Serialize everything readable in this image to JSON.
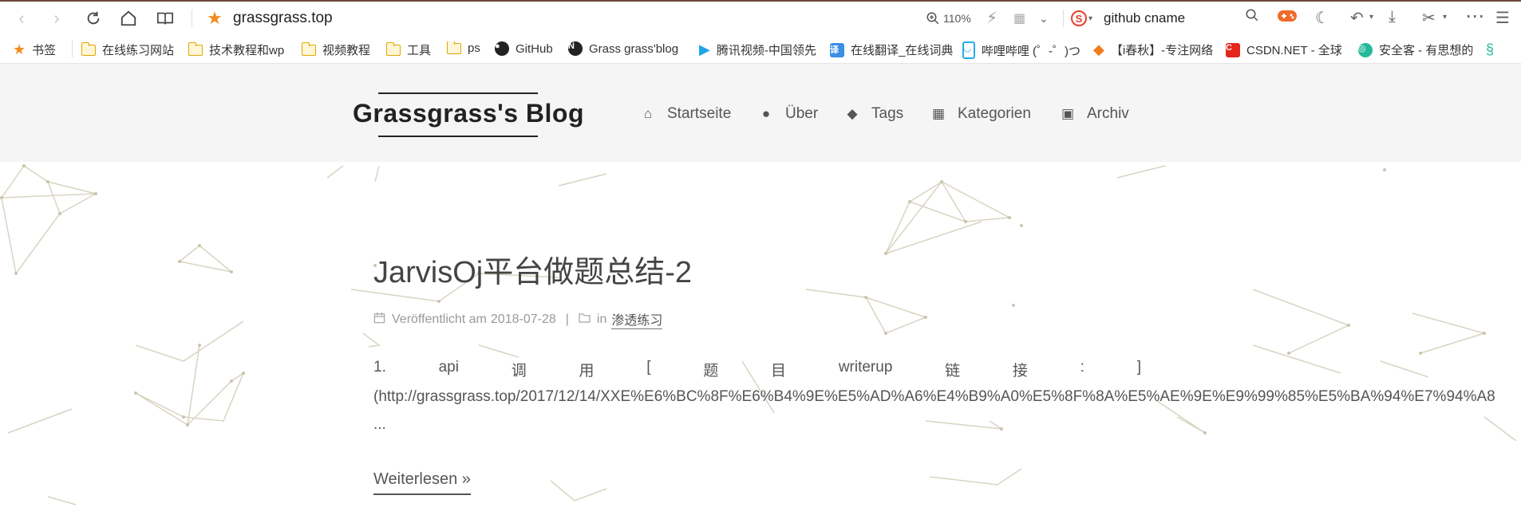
{
  "browser": {
    "url": "grassgrass.top",
    "zoom": "110%",
    "search_value": "github cname",
    "search_engine_icon": "S"
  },
  "bookmarks": [
    {
      "label": "书签",
      "icon": "star"
    },
    {
      "label": "在线练习网站",
      "icon": "folder"
    },
    {
      "label": "技术教程和wp",
      "icon": "folder"
    },
    {
      "label": "视频教程",
      "icon": "folder"
    },
    {
      "label": "工具",
      "icon": "folder"
    },
    {
      "label": "ps",
      "icon": "folder"
    },
    {
      "label": "GitHub",
      "icon": "github"
    },
    {
      "label": "Grass grass'blog",
      "icon": "N"
    },
    {
      "label": "腾讯视频-中国领先",
      "icon": "play"
    },
    {
      "label": "在线翻译_在线词典",
      "icon": "translate"
    },
    {
      "label": "哔哩哔哩 (゜-゜)つ",
      "icon": "tv"
    },
    {
      "label": "【i春秋】-专注网络",
      "icon": "ichunqiu"
    },
    {
      "label": "CSDN.NET - 全球",
      "icon": "C"
    },
    {
      "label": "安全客 - 有思想的",
      "icon": "anquanke"
    }
  ],
  "site": {
    "title": "Grassgrass's Blog",
    "menu": [
      {
        "label": "Startseite",
        "icon": "home-icon"
      },
      {
        "label": "Über",
        "icon": "user-icon"
      },
      {
        "label": "Tags",
        "icon": "tags-icon"
      },
      {
        "label": "Kategorien",
        "icon": "grid-icon"
      },
      {
        "label": "Archiv",
        "icon": "archive-icon"
      }
    ]
  },
  "post": {
    "title": "JarvisOj平台做题总结-2",
    "published_label": "Veröffentlicht am",
    "date": "2018-07-28",
    "separator": "|",
    "in_label": "in",
    "category": "渗透练习",
    "excerpt_line1": [
      "1.",
      "api",
      "调",
      "用",
      "[",
      "题",
      "目",
      "writerup",
      "链",
      "接",
      ":",
      "]"
    ],
    "excerpt_line2": "(http://grassgrass.top/2017/12/14/XXE%E6%BC%8F%E6%B4%9E%E5%AD%A6%E4%B9%A0%E5%8F%8A%E5%AE%9E%E9%99%85%E5%BA%94%E7%94%A8",
    "ellipsis": "...",
    "read_more": "Weiterlesen »"
  },
  "colors": {
    "accent_star": "#f28c1c",
    "header_bg": "#f5f5f5",
    "text": "#555555"
  }
}
